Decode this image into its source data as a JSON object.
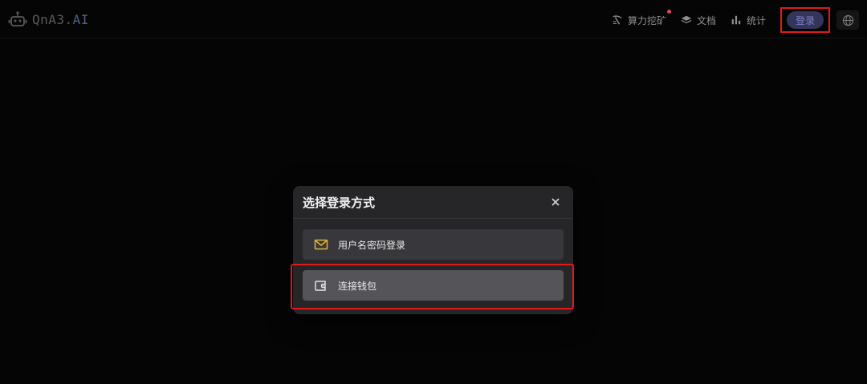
{
  "brand": {
    "name_main": "QnA3.",
    "name_accent": "AI",
    "icon": "robot-icon"
  },
  "nav": {
    "items": [
      {
        "label": "算力挖矿",
        "icon": "mining-icon",
        "has_badge": true
      },
      {
        "label": "文档",
        "icon": "docs-stack-icon"
      },
      {
        "label": "统计",
        "icon": "bar-chart-icon"
      }
    ],
    "login_label": "登录",
    "language_icon": "globe-icon"
  },
  "modal": {
    "title": "选择登录方式",
    "close_icon": "close-icon",
    "options": [
      {
        "label": "用户名密码登录",
        "icon": "mail-icon"
      },
      {
        "label": "连接钱包",
        "icon": "wallet-icon"
      }
    ]
  },
  "colors": {
    "background": "#050505",
    "modal_bg": "#262629",
    "login_btn_bg": "#33355a",
    "login_btn_text": "#7c80c7",
    "highlight": "#e01a1a",
    "mail_icon": "#e2b43a",
    "badge": "#e3484d"
  }
}
